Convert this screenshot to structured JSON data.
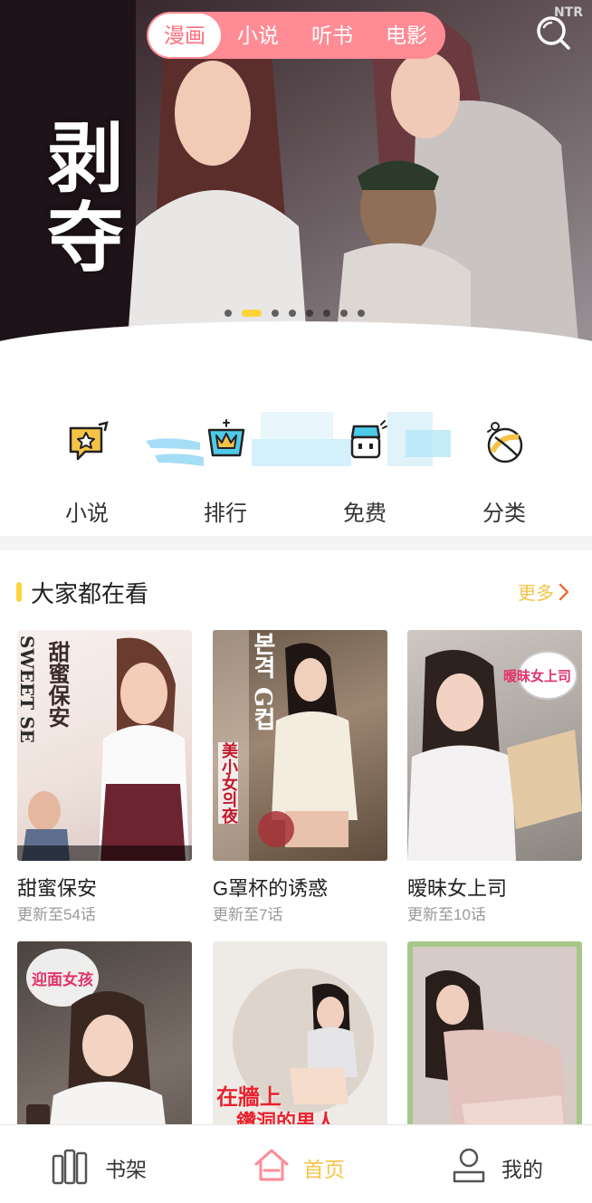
{
  "top_tabs": [
    {
      "label": "漫画",
      "active": true
    },
    {
      "label": "小说",
      "active": false
    },
    {
      "label": "听书",
      "active": false
    },
    {
      "label": "电影",
      "active": false
    }
  ],
  "banner": {
    "title": "剥夺",
    "badge": "NTR",
    "slide_count": 8,
    "active_slide": 2
  },
  "quick_nav": [
    {
      "label": "小说",
      "icon": "star-book-icon"
    },
    {
      "label": "排行",
      "icon": "crown-rank-icon"
    },
    {
      "label": "免费",
      "icon": "free-robot-icon"
    },
    {
      "label": "分类",
      "icon": "category-ball-icon"
    }
  ],
  "section": {
    "title": "大家都在看",
    "more_label": "更多"
  },
  "books": [
    {
      "title": "甜蜜保安",
      "subtitle": "更新至54话",
      "cover_text": "甜蜜保安",
      "cover_text2": "SWEET SE"
    },
    {
      "title": "G罩杯的诱惑",
      "subtitle": "更新至7话",
      "cover_text": "본격 G컵",
      "cover_text2": "美小女의夜"
    },
    {
      "title": "暧昧女上司",
      "subtitle": "更新至10话",
      "cover_text": "暧昧女上司",
      "cover_text2": ""
    },
    {
      "title": "",
      "subtitle": "",
      "cover_text": "迎面女孩",
      "cover_text2": ""
    },
    {
      "title": "",
      "subtitle": "",
      "cover_text": "在牆上",
      "cover_text2": "鑽洞的男人"
    },
    {
      "title": "",
      "subtitle": "",
      "cover_text": "",
      "cover_text2": ""
    }
  ],
  "bottom_nav": [
    {
      "label": "书架",
      "icon": "bookshelf-icon",
      "active": false
    },
    {
      "label": "首页",
      "icon": "home-icon",
      "active": true
    },
    {
      "label": "我的",
      "icon": "user-icon",
      "active": false
    }
  ],
  "colors": {
    "accent_pink": "#ff8b95",
    "accent_yellow": "#f6c347",
    "text_dark": "#222222",
    "text_muted": "#999999"
  }
}
